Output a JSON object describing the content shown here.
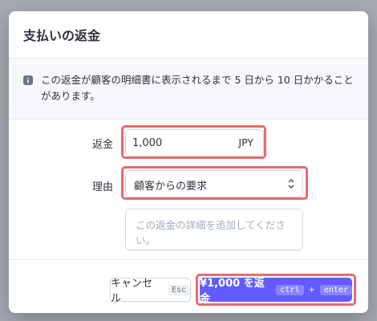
{
  "modal": {
    "title": "支払いの返金",
    "info_text_line1": "この返金が顧客の明細書に表示されるまで 5 日から 10 日かかること",
    "info_text_line2": "があります。"
  },
  "form": {
    "amount_label": "返金",
    "amount_value": "1,000",
    "currency": "JPY",
    "reason_label": "理由",
    "reason_value": "顧客からの要求",
    "details_placeholder": "この返金の詳細を追加してください。"
  },
  "footer": {
    "cancel_label": "キャンセル",
    "cancel_shortcut": "Esc",
    "refund_label": "¥1,000 を返金",
    "refund_shortcut_1": "ctrl",
    "refund_shortcut_plus": "+",
    "refund_shortcut_2": "enter"
  },
  "colors": {
    "primary": "#635bff",
    "highlight": "#ea6c6c",
    "text": "#30313d"
  }
}
